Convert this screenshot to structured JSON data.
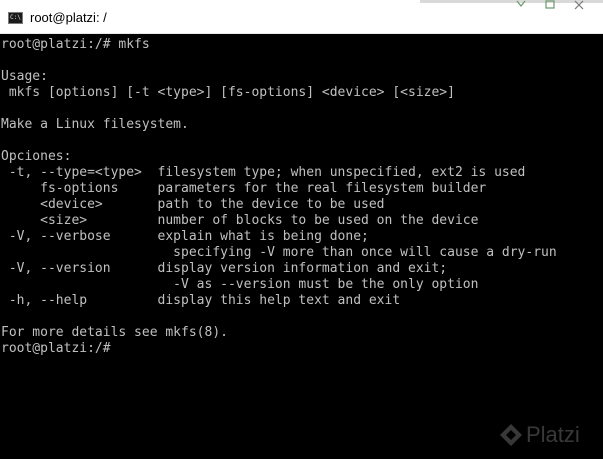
{
  "window": {
    "title": "root@platzi: /",
    "icon": "console-icon",
    "controls": [
      "minimize",
      "maximize",
      "close"
    ]
  },
  "console": {
    "lines": [
      "root@platzi:/# mkfs",
      "",
      "Usage:",
      " mkfs [options] [-t <type>] [fs-options] <device> [<size>]",
      "",
      "Make a Linux filesystem.",
      "",
      "Opciones:",
      " -t, --type=<type>  filesystem type; when unspecified, ext2 is used",
      "     fs-options     parameters for the real filesystem builder",
      "     <device>       path to the device to be used",
      "     <size>         number of blocks to be used on the device",
      " -V, --verbose      explain what is being done;",
      "                      specifying -V more than once will cause a dry-run",
      " -V, --version      display version information and exit;",
      "                      -V as --version must be the only option",
      " -h, --help         display this help text and exit",
      "",
      "For more details see mkfs(8).",
      "root@platzi:/# "
    ]
  },
  "watermark": {
    "text": "Platzi"
  },
  "colors": {
    "background": "#000000",
    "foreground": "#c0c0c0",
    "titlebar": "#ffffff"
  }
}
